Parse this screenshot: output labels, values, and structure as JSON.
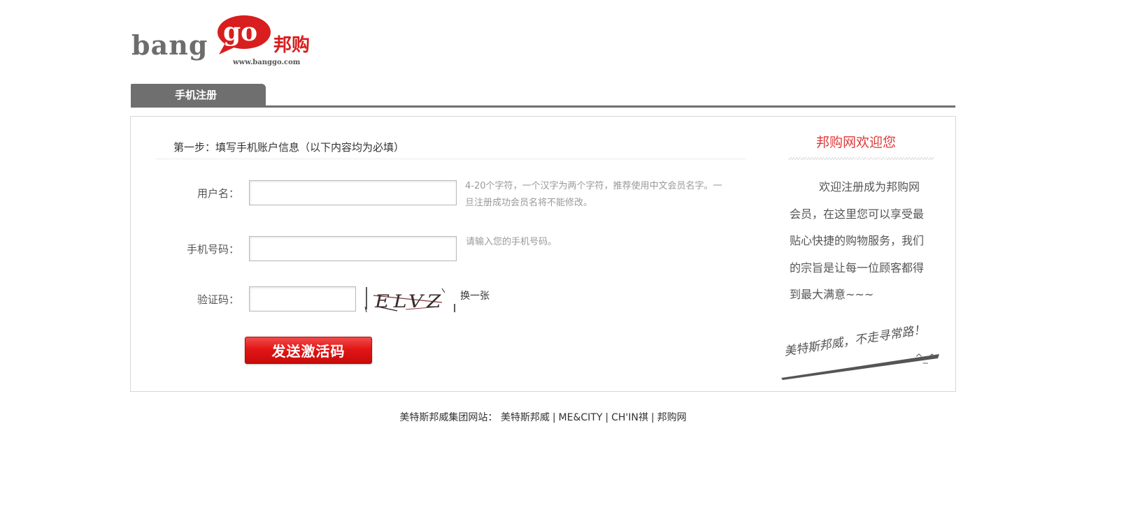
{
  "logo": {
    "bang": "bang",
    "go": "go",
    "cn": "邦购",
    "url": "www.banggo.com"
  },
  "tab": {
    "label": "手机注册"
  },
  "form": {
    "step_title": "第一步：填写手机账户信息（以下内容均为必填）",
    "username": {
      "label": "用户名：",
      "value": "",
      "hint": "4-20个字符，一个汉字为两个字符，推荐使用中文会员名字。一旦注册成功会员名将不能修改。"
    },
    "phone": {
      "label": "手机号码：",
      "value": "",
      "hint": "请输入您的手机号码。"
    },
    "captcha": {
      "label": "验证码：",
      "value": "",
      "image_text": "ELVZ",
      "refresh_label": "换一张"
    },
    "submit_label": "发送激活码"
  },
  "welcome": {
    "title": "邦购网欢迎您",
    "text": "欢迎注册成为邦购网会员，在这里您可以享受最贴心快捷的购物服务，我们的宗旨是让每一位顾客都得到最大满意~~~",
    "signature": "美特斯邦威，不走寻常路！",
    "smile": "^_^"
  },
  "footer": {
    "prefix": "美特斯邦威集团网站：",
    "links": [
      "美特斯邦威",
      "ME&CITY",
      "CH'IN祺",
      "邦购网"
    ],
    "separator": "|"
  },
  "colors": {
    "brand_red": "#e21616",
    "tab_gray": "#6f6f6f",
    "welcome_red": "#e03a3a"
  }
}
